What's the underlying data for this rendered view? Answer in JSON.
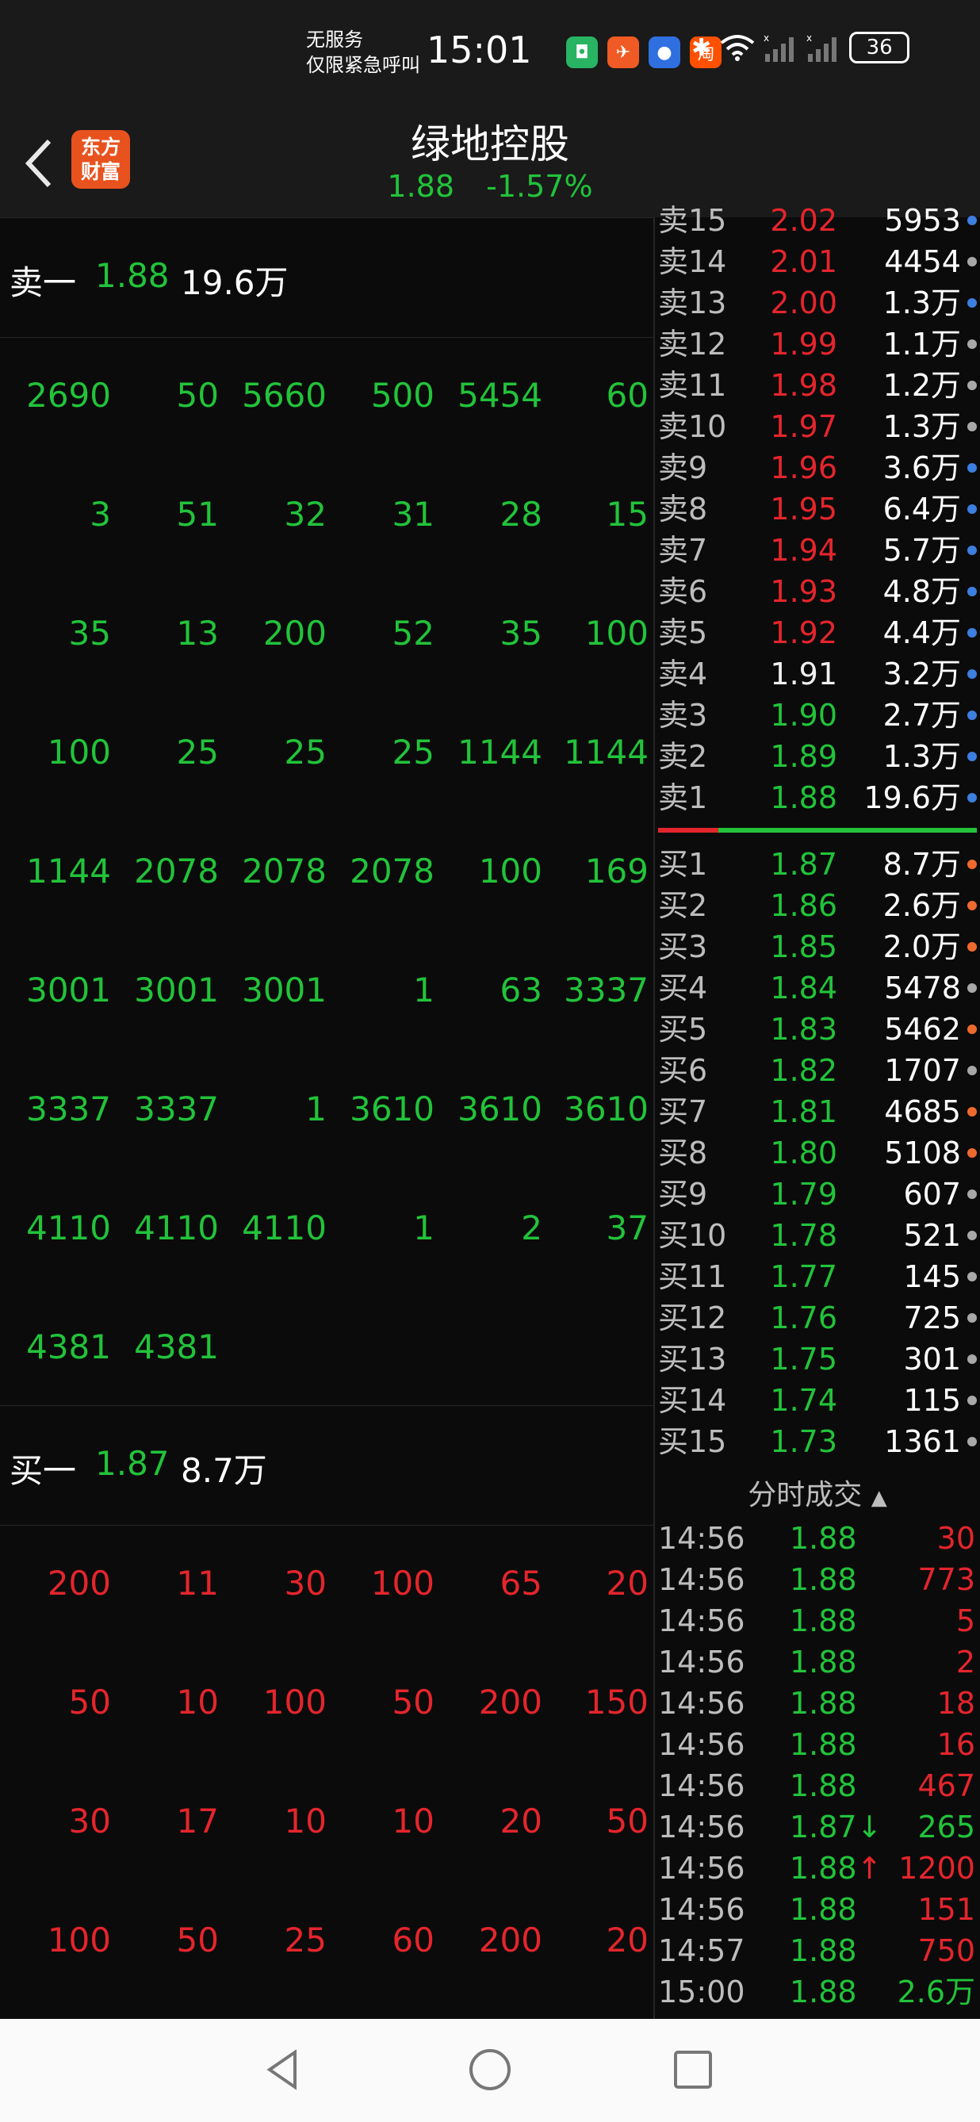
{
  "status_bar": {
    "carrier_line1": "无服务",
    "carrier_line2": "仅限紧急呼叫",
    "time": "15:01",
    "battery": "36",
    "icons": [
      "app-icon-green",
      "app-icon-orange",
      "app-icon-blue",
      "taobao-icon",
      "bluetooth-icon",
      "wifi-icon",
      "signal-icon",
      "signal-icon"
    ]
  },
  "header": {
    "logo_line1": "东方",
    "logo_line2": "财富",
    "title": "绿地控股",
    "price": "1.88",
    "change": "-1.57%"
  },
  "queue": {
    "ask": {
      "label": "卖一",
      "price": "1.88",
      "volume": "19.6万"
    },
    "ask_orders": [
      [
        "2690",
        "50",
        "5660",
        "500",
        "5454",
        "60"
      ],
      [
        "3",
        "51",
        "32",
        "31",
        "28",
        "15"
      ],
      [
        "35",
        "13",
        "200",
        "52",
        "35",
        "100"
      ],
      [
        "100",
        "25",
        "25",
        "25",
        "1144",
        "1144"
      ],
      [
        "1144",
        "2078",
        "2078",
        "2078",
        "100",
        "169"
      ],
      [
        "3001",
        "3001",
        "3001",
        "1",
        "63",
        "3337"
      ],
      [
        "3337",
        "3337",
        "1",
        "3610",
        "3610",
        "3610"
      ],
      [
        "4110",
        "4110",
        "4110",
        "1",
        "2",
        "37"
      ],
      [
        "4381",
        "4381"
      ]
    ],
    "bid": {
      "label": "买一",
      "price": "1.87",
      "volume": "8.7万"
    },
    "bid_orders": [
      [
        "200",
        "11",
        "30",
        "100",
        "65",
        "20"
      ],
      [
        "50",
        "10",
        "100",
        "50",
        "200",
        "150"
      ],
      [
        "30",
        "17",
        "10",
        "10",
        "20",
        "50"
      ],
      [
        "100",
        "50",
        "25",
        "60",
        "200",
        "20"
      ]
    ]
  },
  "order_book": {
    "top_partial": {
      "label": "卖15",
      "price": "2.02",
      "volume": "5953"
    },
    "asks": [
      {
        "label": "卖14",
        "price": "2.01",
        "volume": "4454",
        "price_color": "red",
        "dot": "gray"
      },
      {
        "label": "卖13",
        "price": "2.00",
        "volume": "1.3万",
        "price_color": "red",
        "dot": "blue"
      },
      {
        "label": "卖12",
        "price": "1.99",
        "volume": "1.1万",
        "price_color": "red",
        "dot": "gray"
      },
      {
        "label": "卖11",
        "price": "1.98",
        "volume": "1.2万",
        "price_color": "red",
        "dot": "gray"
      },
      {
        "label": "卖10",
        "price": "1.97",
        "volume": "1.3万",
        "price_color": "red",
        "dot": "gray"
      },
      {
        "label": "卖9",
        "price": "1.96",
        "volume": "3.6万",
        "price_color": "red",
        "dot": "blue"
      },
      {
        "label": "卖8",
        "price": "1.95",
        "volume": "6.4万",
        "price_color": "red",
        "dot": "blue"
      },
      {
        "label": "卖7",
        "price": "1.94",
        "volume": "5.7万",
        "price_color": "red",
        "dot": "blue"
      },
      {
        "label": "卖6",
        "price": "1.93",
        "volume": "4.8万",
        "price_color": "red",
        "dot": "blue"
      },
      {
        "label": "卖5",
        "price": "1.92",
        "volume": "4.4万",
        "price_color": "red",
        "dot": "blue"
      },
      {
        "label": "卖4",
        "price": "1.91",
        "volume": "3.2万",
        "price_color": "white",
        "dot": "blue"
      },
      {
        "label": "卖3",
        "price": "1.90",
        "volume": "2.7万",
        "price_color": "green",
        "dot": "blue"
      },
      {
        "label": "卖2",
        "price": "1.89",
        "volume": "1.3万",
        "price_color": "green",
        "dot": "blue"
      },
      {
        "label": "卖1",
        "price": "1.88",
        "volume": "19.6万",
        "price_color": "green",
        "dot": "blue"
      }
    ],
    "bids": [
      {
        "label": "买1",
        "price": "1.87",
        "volume": "8.7万",
        "price_color": "green",
        "dot": "orange"
      },
      {
        "label": "买2",
        "price": "1.86",
        "volume": "2.6万",
        "price_color": "green",
        "dot": "orange"
      },
      {
        "label": "买3",
        "price": "1.85",
        "volume": "2.0万",
        "price_color": "green",
        "dot": "orange"
      },
      {
        "label": "买4",
        "price": "1.84",
        "volume": "5478",
        "price_color": "green",
        "dot": "gray"
      },
      {
        "label": "买5",
        "price": "1.83",
        "volume": "5462",
        "price_color": "green",
        "dot": "orange"
      },
      {
        "label": "买6",
        "price": "1.82",
        "volume": "1707",
        "price_color": "green",
        "dot": "gray"
      },
      {
        "label": "买7",
        "price": "1.81",
        "volume": "4685",
        "price_color": "green",
        "dot": "orange"
      },
      {
        "label": "买8",
        "price": "1.80",
        "volume": "5108",
        "price_color": "green",
        "dot": "orange"
      },
      {
        "label": "买9",
        "price": "1.79",
        "volume": "607",
        "price_color": "green",
        "dot": "gray"
      },
      {
        "label": "买10",
        "price": "1.78",
        "volume": "521",
        "price_color": "green",
        "dot": "gray"
      },
      {
        "label": "买11",
        "price": "1.77",
        "volume": "145",
        "price_color": "green",
        "dot": "gray"
      },
      {
        "label": "买12",
        "price": "1.76",
        "volume": "725",
        "price_color": "green",
        "dot": "gray"
      },
      {
        "label": "买13",
        "price": "1.75",
        "volume": "301",
        "price_color": "green",
        "dot": "gray"
      },
      {
        "label": "买14",
        "price": "1.74",
        "volume": "115",
        "price_color": "green",
        "dot": "gray"
      },
      {
        "label": "买15",
        "price": "1.73",
        "volume": "1361",
        "price_color": "green",
        "dot": "gray"
      }
    ],
    "spread_bar": {
      "sell_fraction": 0.19,
      "sell_color": "#e4252c",
      "buy_color": "#22c33a"
    }
  },
  "ticks": {
    "title": "分时成交",
    "rows": [
      {
        "time": "14:56",
        "price": "1.88",
        "arrow": "",
        "volume": "30",
        "color": "red"
      },
      {
        "time": "14:56",
        "price": "1.88",
        "arrow": "",
        "volume": "773",
        "color": "red"
      },
      {
        "time": "14:56",
        "price": "1.88",
        "arrow": "",
        "volume": "5",
        "color": "red"
      },
      {
        "time": "14:56",
        "price": "1.88",
        "arrow": "",
        "volume": "2",
        "color": "red"
      },
      {
        "time": "14:56",
        "price": "1.88",
        "arrow": "",
        "volume": "18",
        "color": "red"
      },
      {
        "time": "14:56",
        "price": "1.88",
        "arrow": "",
        "volume": "16",
        "color": "red"
      },
      {
        "time": "14:56",
        "price": "1.88",
        "arrow": "",
        "volume": "467",
        "color": "red"
      },
      {
        "time": "14:56",
        "price": "1.87",
        "arrow": "↓",
        "volume": "265",
        "color": "green"
      },
      {
        "time": "14:56",
        "price": "1.88",
        "arrow": "↑",
        "volume": "1200",
        "color": "red"
      },
      {
        "time": "14:56",
        "price": "1.88",
        "arrow": "",
        "volume": "151",
        "color": "red"
      },
      {
        "time": "14:57",
        "price": "1.88",
        "arrow": "",
        "volume": "750",
        "color": "red"
      },
      {
        "time": "15:00",
        "price": "1.88",
        "arrow": "",
        "volume": "2.6万",
        "color": "green"
      }
    ]
  },
  "colors": {
    "up": "#e4252c",
    "down": "#22c33a",
    "dot_blue": "#3d7fe0",
    "dot_orange": "#ee6a2c",
    "dot_gray": "#a8a8a8"
  },
  "navigation": {
    "icons": [
      "back-triangle-icon",
      "home-circle-icon",
      "recents-square-icon"
    ]
  }
}
